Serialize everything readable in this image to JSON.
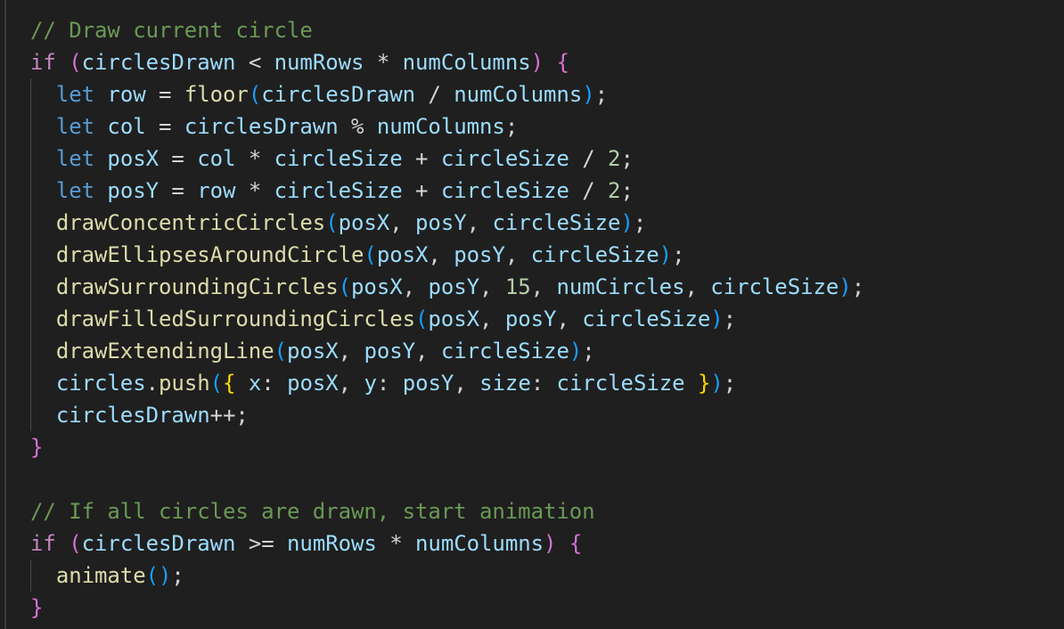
{
  "editor": {
    "lines": [
      [
        [
          "// Draw current circle",
          "c"
        ]
      ],
      [
        [
          "if",
          "k"
        ],
        [
          " ",
          "p"
        ],
        [
          "(",
          "b3"
        ],
        [
          "circlesDrawn",
          "v"
        ],
        [
          " < ",
          "p"
        ],
        [
          "numRows",
          "v"
        ],
        [
          " * ",
          "p"
        ],
        [
          "numColumns",
          "v"
        ],
        [
          ")",
          "b3"
        ],
        [
          " ",
          "p"
        ],
        [
          "{",
          "b3"
        ]
      ],
      [
        [
          "  ",
          "p"
        ],
        [
          "let",
          "s"
        ],
        [
          " ",
          "p"
        ],
        [
          "row",
          "v"
        ],
        [
          " = ",
          "p"
        ],
        [
          "floor",
          "f"
        ],
        [
          "(",
          "b1"
        ],
        [
          "circlesDrawn",
          "v"
        ],
        [
          " / ",
          "p"
        ],
        [
          "numColumns",
          "v"
        ],
        [
          ")",
          "b1"
        ],
        [
          ";",
          "p"
        ]
      ],
      [
        [
          "  ",
          "p"
        ],
        [
          "let",
          "s"
        ],
        [
          " ",
          "p"
        ],
        [
          "col",
          "v"
        ],
        [
          " = ",
          "p"
        ],
        [
          "circlesDrawn",
          "v"
        ],
        [
          " % ",
          "p"
        ],
        [
          "numColumns",
          "v"
        ],
        [
          ";",
          "p"
        ]
      ],
      [
        [
          "  ",
          "p"
        ],
        [
          "let",
          "s"
        ],
        [
          " ",
          "p"
        ],
        [
          "posX",
          "v"
        ],
        [
          " = ",
          "p"
        ],
        [
          "col",
          "v"
        ],
        [
          " * ",
          "p"
        ],
        [
          "circleSize",
          "v"
        ],
        [
          " + ",
          "p"
        ],
        [
          "circleSize",
          "v"
        ],
        [
          " / ",
          "p"
        ],
        [
          "2",
          "n"
        ],
        [
          ";",
          "p"
        ]
      ],
      [
        [
          "  ",
          "p"
        ],
        [
          "let",
          "s"
        ],
        [
          " ",
          "p"
        ],
        [
          "posY",
          "v"
        ],
        [
          " = ",
          "p"
        ],
        [
          "row",
          "v"
        ],
        [
          " * ",
          "p"
        ],
        [
          "circleSize",
          "v"
        ],
        [
          " + ",
          "p"
        ],
        [
          "circleSize",
          "v"
        ],
        [
          " / ",
          "p"
        ],
        [
          "2",
          "n"
        ],
        [
          ";",
          "p"
        ]
      ],
      [
        [
          "  ",
          "p"
        ],
        [
          "drawConcentricCircles",
          "f"
        ],
        [
          "(",
          "b1"
        ],
        [
          "posX",
          "v"
        ],
        [
          ", ",
          "p"
        ],
        [
          "posY",
          "v"
        ],
        [
          ", ",
          "p"
        ],
        [
          "circleSize",
          "v"
        ],
        [
          ")",
          "b1"
        ],
        [
          ";",
          "p"
        ]
      ],
      [
        [
          "  ",
          "p"
        ],
        [
          "drawEllipsesAroundCircle",
          "f"
        ],
        [
          "(",
          "b1"
        ],
        [
          "posX",
          "v"
        ],
        [
          ", ",
          "p"
        ],
        [
          "posY",
          "v"
        ],
        [
          ", ",
          "p"
        ],
        [
          "circleSize",
          "v"
        ],
        [
          ")",
          "b1"
        ],
        [
          ";",
          "p"
        ]
      ],
      [
        [
          "  ",
          "p"
        ],
        [
          "drawSurroundingCircles",
          "f"
        ],
        [
          "(",
          "b1"
        ],
        [
          "posX",
          "v"
        ],
        [
          ", ",
          "p"
        ],
        [
          "posY",
          "v"
        ],
        [
          ", ",
          "p"
        ],
        [
          "15",
          "n"
        ],
        [
          ", ",
          "p"
        ],
        [
          "numCircles",
          "v"
        ],
        [
          ", ",
          "p"
        ],
        [
          "circleSize",
          "v"
        ],
        [
          ")",
          "b1"
        ],
        [
          ";",
          "p"
        ]
      ],
      [
        [
          "  ",
          "p"
        ],
        [
          "drawFilledSurroundingCircles",
          "f"
        ],
        [
          "(",
          "b1"
        ],
        [
          "posX",
          "v"
        ],
        [
          ", ",
          "p"
        ],
        [
          "posY",
          "v"
        ],
        [
          ", ",
          "p"
        ],
        [
          "circleSize",
          "v"
        ],
        [
          ")",
          "b1"
        ],
        [
          ";",
          "p"
        ]
      ],
      [
        [
          "  ",
          "p"
        ],
        [
          "drawExtendingLine",
          "f"
        ],
        [
          "(",
          "b1"
        ],
        [
          "posX",
          "v"
        ],
        [
          ", ",
          "p"
        ],
        [
          "posY",
          "v"
        ],
        [
          ", ",
          "p"
        ],
        [
          "circleSize",
          "v"
        ],
        [
          ")",
          "b1"
        ],
        [
          ";",
          "p"
        ]
      ],
      [
        [
          "  ",
          "p"
        ],
        [
          "circles",
          "v"
        ],
        [
          ".",
          "p"
        ],
        [
          "push",
          "f"
        ],
        [
          "(",
          "b1"
        ],
        [
          "{",
          "b2"
        ],
        [
          " ",
          "p"
        ],
        [
          "x",
          "v"
        ],
        [
          ": ",
          "p"
        ],
        [
          "posX",
          "v"
        ],
        [
          ", ",
          "p"
        ],
        [
          "y",
          "v"
        ],
        [
          ": ",
          "p"
        ],
        [
          "posY",
          "v"
        ],
        [
          ", ",
          "p"
        ],
        [
          "size",
          "v"
        ],
        [
          ": ",
          "p"
        ],
        [
          "circleSize",
          "v"
        ],
        [
          " ",
          "p"
        ],
        [
          "}",
          "b2"
        ],
        [
          ")",
          "b1"
        ],
        [
          ";",
          "p"
        ]
      ],
      [
        [
          "  ",
          "p"
        ],
        [
          "circlesDrawn",
          "v"
        ],
        [
          "++;",
          "p"
        ]
      ],
      [
        [
          "}",
          "b3"
        ]
      ],
      [],
      [
        [
          "// If all circles are drawn, start animation",
          "c"
        ]
      ],
      [
        [
          "if",
          "k"
        ],
        [
          " ",
          "p"
        ],
        [
          "(",
          "b3"
        ],
        [
          "circlesDrawn",
          "v"
        ],
        [
          " >= ",
          "p"
        ],
        [
          "numRows",
          "v"
        ],
        [
          " * ",
          "p"
        ],
        [
          "numColumns",
          "v"
        ],
        [
          ")",
          "b3"
        ],
        [
          " ",
          "p"
        ],
        [
          "{",
          "b3"
        ]
      ],
      [
        [
          "  ",
          "p"
        ],
        [
          "animate",
          "f"
        ],
        [
          "(",
          "b1"
        ],
        [
          ")",
          "b1"
        ],
        [
          ";",
          "p"
        ]
      ],
      [
        [
          "}",
          "b3"
        ]
      ]
    ]
  }
}
